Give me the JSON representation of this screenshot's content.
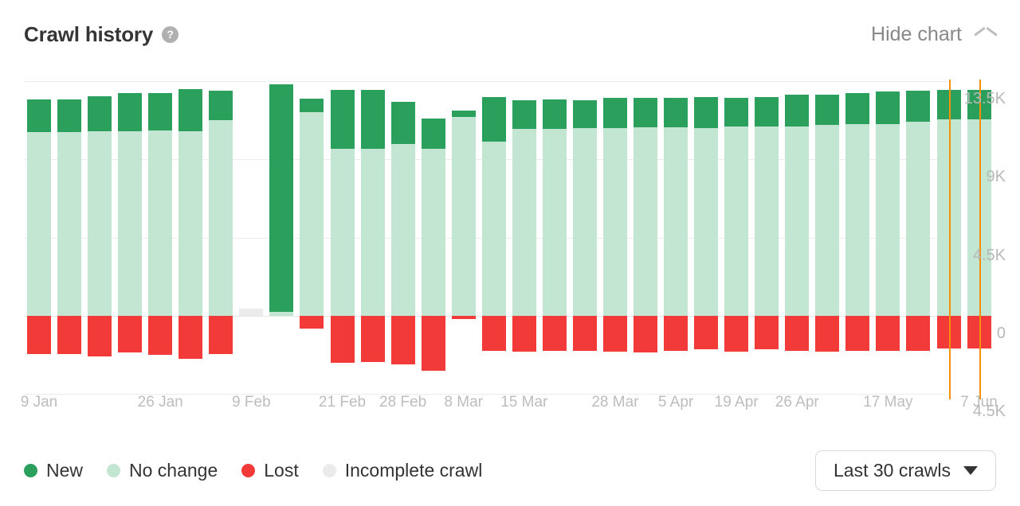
{
  "header": {
    "title": "Crawl history",
    "help_icon": "question-mark-icon",
    "hide_chart_label": "Hide chart",
    "collapse_icon": "chevron-up-icon"
  },
  "legend": [
    {
      "label": "New",
      "color": "#2ba05d",
      "key": "new"
    },
    {
      "label": "No change",
      "color": "#c3e6d3",
      "key": "no_change"
    },
    {
      "label": "Lost",
      "color": "#f23a38",
      "key": "lost"
    },
    {
      "label": "Incomplete crawl",
      "color": "#ebebeb",
      "key": "incomplete"
    }
  ],
  "range_select": {
    "value": "Last 30 crawls",
    "caret_icon": "caret-down-icon"
  },
  "chart_data": {
    "type": "bar",
    "subtype": "stacked-diverging",
    "title": "Crawl history",
    "xlabel": "",
    "ylabel": "",
    "grid": true,
    "legend_position": "bottom-left",
    "y_axis": {
      "ticks": [
        "13.5K",
        "9K",
        "4.5K",
        "0",
        "4.5K"
      ],
      "tick_values": [
        13500,
        9000,
        4500,
        0,
        -4500
      ],
      "positive_max": 13500,
      "negative_max": -4500
    },
    "x_tick_labels": [
      "9 Jan",
      "26 Jan",
      "9 Feb",
      "21 Feb",
      "28 Feb",
      "8 Mar",
      "15 Mar",
      "28 Mar",
      "5 Apr",
      "19 Apr",
      "26 Apr",
      "17 May",
      "7 Jun"
    ],
    "x_tick_bar_index": [
      0,
      4,
      7,
      10,
      12,
      14,
      16,
      19,
      21,
      23,
      25,
      28,
      31
    ],
    "series": [
      {
        "name": "New",
        "key": "new",
        "color": "#2ba05d"
      },
      {
        "name": "No change",
        "key": "no_change",
        "color": "#c3e6d3"
      },
      {
        "name": "Lost",
        "key": "lost",
        "color": "#f23a38"
      },
      {
        "name": "Incomplete crawl",
        "key": "incomplete",
        "color": "#ebebeb"
      }
    ],
    "markers": [
      {
        "bar_index": 30,
        "color": "#f79009"
      },
      {
        "bar_index": 31,
        "color": "#f79009"
      }
    ],
    "bars": [
      {
        "new": 1900,
        "no_change": 10550,
        "lost": -2200,
        "incomplete": 0
      },
      {
        "new": 1880,
        "no_change": 10570,
        "lost": -2200,
        "incomplete": 0
      },
      {
        "new": 2000,
        "no_change": 10620,
        "lost": -2350,
        "incomplete": 0
      },
      {
        "new": 2200,
        "no_change": 10620,
        "lost": -2100,
        "incomplete": 0
      },
      {
        "new": 2150,
        "no_change": 10650,
        "lost": -2270,
        "incomplete": 0
      },
      {
        "new": 2400,
        "no_change": 10620,
        "lost": -2500,
        "incomplete": 0
      },
      {
        "new": 1700,
        "no_change": 11250,
        "lost": -2200,
        "incomplete": 0
      },
      {
        "new": 0,
        "no_change": 0,
        "lost": 0,
        "incomplete": 300
      },
      {
        "new": 13050,
        "no_change": 250,
        "lost": 0,
        "incomplete": 0
      },
      {
        "new": 800,
        "no_change": 11700,
        "lost": -750,
        "incomplete": 0
      },
      {
        "new": 3400,
        "no_change": 9600,
        "lost": -2700,
        "incomplete": 0
      },
      {
        "new": 3400,
        "no_change": 9600,
        "lost": -2650,
        "incomplete": 0
      },
      {
        "new": 2400,
        "no_change": 9900,
        "lost": -2800,
        "incomplete": 0
      },
      {
        "new": 1750,
        "no_change": 9600,
        "lost": -3150,
        "incomplete": 0
      },
      {
        "new": 350,
        "no_change": 11450,
        "lost": -200,
        "incomplete": 0
      },
      {
        "new": 2600,
        "no_change": 10000,
        "lost": -2000,
        "incomplete": 0
      },
      {
        "new": 1650,
        "no_change": 10750,
        "lost": -2050,
        "incomplete": 0
      },
      {
        "new": 1700,
        "no_change": 10750,
        "lost": -2000,
        "incomplete": 0
      },
      {
        "new": 1600,
        "no_change": 10800,
        "lost": -2000,
        "incomplete": 0
      },
      {
        "new": 1750,
        "no_change": 10800,
        "lost": -2050,
        "incomplete": 0
      },
      {
        "new": 1700,
        "no_change": 10850,
        "lost": -2100,
        "incomplete": 0
      },
      {
        "new": 1700,
        "no_change": 10850,
        "lost": -2000,
        "incomplete": 0
      },
      {
        "new": 1800,
        "no_change": 10800,
        "lost": -1950,
        "incomplete": 0
      },
      {
        "new": 1650,
        "no_change": 10900,
        "lost": -2050,
        "incomplete": 0
      },
      {
        "new": 1700,
        "no_change": 10900,
        "lost": -1950,
        "incomplete": 0
      },
      {
        "new": 1800,
        "no_change": 10900,
        "lost": -2000,
        "incomplete": 0
      },
      {
        "new": 1700,
        "no_change": 11000,
        "lost": -2050,
        "incomplete": 0
      },
      {
        "new": 1750,
        "no_change": 11050,
        "lost": -2000,
        "incomplete": 0
      },
      {
        "new": 1850,
        "no_change": 11050,
        "lost": -2000,
        "incomplete": 0
      },
      {
        "new": 1800,
        "no_change": 11150,
        "lost": -2000,
        "incomplete": 0
      },
      {
        "new": 1700,
        "no_change": 11300,
        "lost": -1900,
        "incomplete": 0
      },
      {
        "new": 1700,
        "no_change": 11300,
        "lost": -1900,
        "incomplete": 0
      }
    ]
  }
}
